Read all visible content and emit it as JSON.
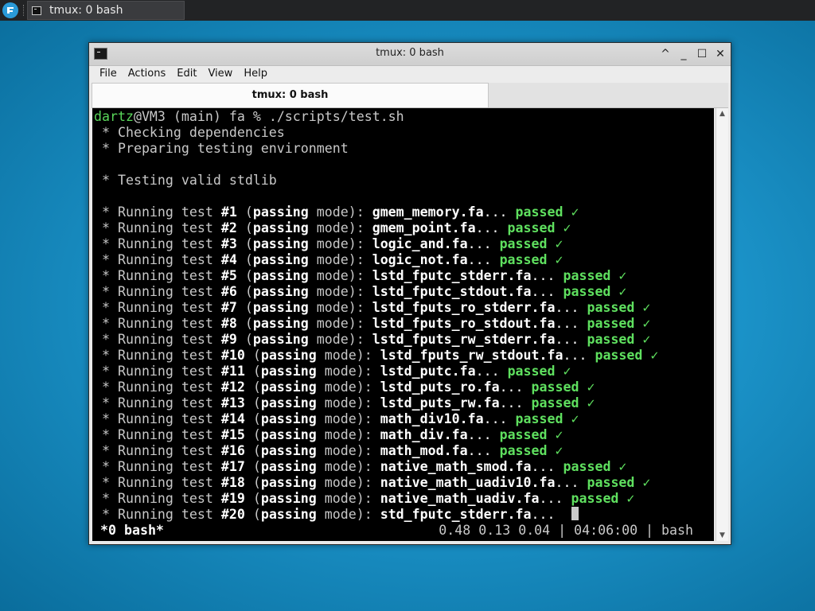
{
  "taskbar": {
    "task_label": "tmux: 0 bash"
  },
  "window": {
    "title": "tmux: 0 bash",
    "menu": [
      "File",
      "Actions",
      "Edit",
      "View",
      "Help"
    ],
    "tab_label": "tmux: 0 bash"
  },
  "terminal": {
    "prompt": {
      "user": "dartz",
      "host": "@VM3",
      "branch": " (main)",
      "cwd": " fa",
      "symbol": " % ",
      "command": "./scripts/test.sh"
    },
    "messages": [
      " * Checking dependencies",
      " * Preparing testing environment",
      "",
      " * Testing valid stdlib",
      ""
    ],
    "tests": [
      {
        "num": "#1",
        "file": "gmem_memory.fa",
        "result": "passed ✓"
      },
      {
        "num": "#2",
        "file": "gmem_point.fa",
        "result": "passed ✓"
      },
      {
        "num": "#3",
        "file": "logic_and.fa",
        "result": "passed ✓"
      },
      {
        "num": "#4",
        "file": "logic_not.fa",
        "result": "passed ✓"
      },
      {
        "num": "#5",
        "file": "lstd_fputc_stderr.fa",
        "result": "passed ✓"
      },
      {
        "num": "#6",
        "file": "lstd_fputc_stdout.fa",
        "result": "passed ✓"
      },
      {
        "num": "#7",
        "file": "lstd_fputs_ro_stderr.fa",
        "result": "passed ✓"
      },
      {
        "num": "#8",
        "file": "lstd_fputs_ro_stdout.fa",
        "result": "passed ✓"
      },
      {
        "num": "#9",
        "file": "lstd_fputs_rw_stderr.fa",
        "result": "passed ✓"
      },
      {
        "num": "#10",
        "file": "lstd_fputs_rw_stdout.fa",
        "result": "passed ✓"
      },
      {
        "num": "#11",
        "file": "lstd_putc.fa",
        "result": "passed ✓"
      },
      {
        "num": "#12",
        "file": "lstd_puts_ro.fa",
        "result": "passed ✓"
      },
      {
        "num": "#13",
        "file": "lstd_puts_rw.fa",
        "result": "passed ✓"
      },
      {
        "num": "#14",
        "file": "math_div10.fa",
        "result": "passed ✓"
      },
      {
        "num": "#15",
        "file": "math_div.fa",
        "result": "passed ✓"
      },
      {
        "num": "#16",
        "file": "math_mod.fa",
        "result": "passed ✓"
      },
      {
        "num": "#17",
        "file": "native_math_smod.fa",
        "result": "passed ✓"
      },
      {
        "num": "#18",
        "file": "native_math_uadiv10.fa",
        "result": "passed ✓"
      },
      {
        "num": "#19",
        "file": "native_math_uadiv.fa",
        "result": "passed ✓"
      },
      {
        "num": "#20",
        "file": "std_fputc_stderr.fa",
        "result": ""
      }
    ],
    "test_text": {
      "bullet": " * ",
      "running": "Running test ",
      "open": " (",
      "mode_word": "passing",
      "mode_tail": " mode): ",
      "dots": "... "
    },
    "status_left": "*0 bash*",
    "status_right": "0.48 0.13 0.04 | 04:06:00 | bash"
  },
  "colors": {
    "prompt_green": "#59d65a",
    "passed_green": "#5fe05f",
    "terminal_bg": "#000000",
    "desktop": "#1b93c9"
  },
  "icons": {
    "start": "distro-logo-icon",
    "terminal": "terminal-icon"
  }
}
